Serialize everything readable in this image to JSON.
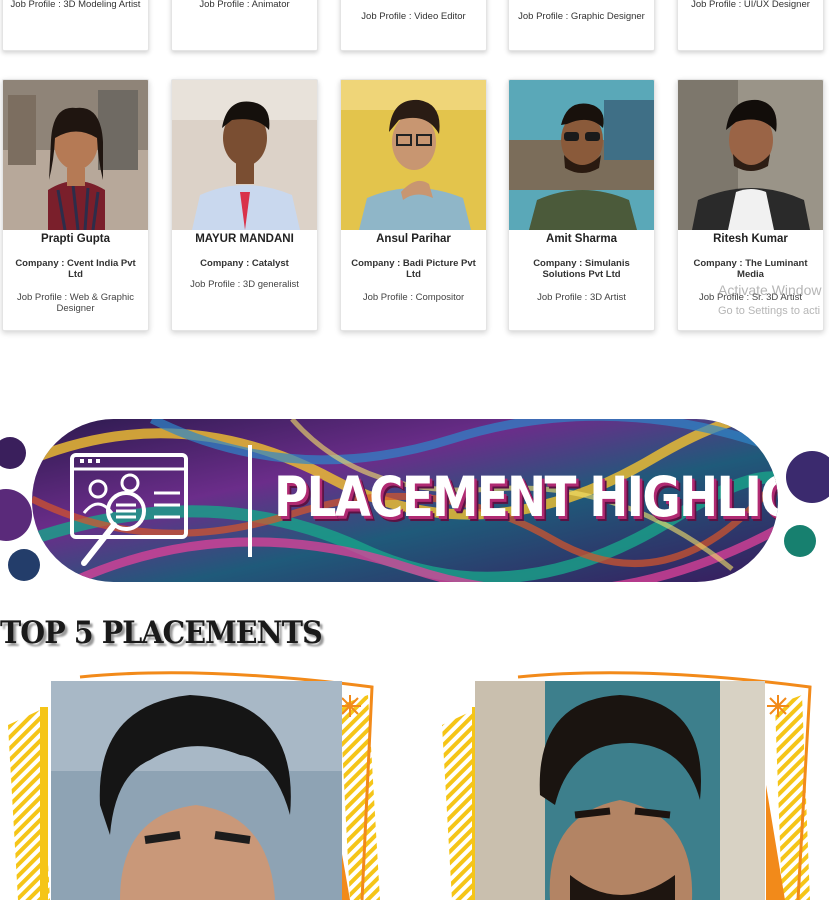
{
  "top_row": [
    {
      "job": "Job Profile : 3D Modeling Artist"
    },
    {
      "job": "Job Profile : Animator"
    },
    {
      "job": "Job Profile : Video Editor"
    },
    {
      "job": "Job Profile : Graphic Designer"
    },
    {
      "job": "Job Profile : UI/UX Designer"
    }
  ],
  "students": [
    {
      "name": "Prapti Gupta",
      "company": "Company : Cvent India Pvt Ltd",
      "job": "Job Profile : Web & Graphic Designer"
    },
    {
      "name": "MAYUR MANDANI",
      "company": "Company : Catalyst",
      "job": "Job Profile : 3D generalist"
    },
    {
      "name": "Ansul Parihar",
      "company": "Company : Badi Picture Pvt Ltd",
      "job": "Job Profile : Compositor"
    },
    {
      "name": "Amit Sharma",
      "company": "Company : Simulanis Solutions Pvt Ltd",
      "job": "Job Profile : 3D Artist"
    },
    {
      "name": "Ritesh Kumar",
      "company": "Company : The Luminant Media",
      "job": "Job Profile : Sr. 3D Artist"
    }
  ],
  "watermark": {
    "line1": "Activate Window",
    "line2": "Go to Settings to acti"
  },
  "banner": {
    "title": "PLACEMENT HIGHLIGHTS",
    "icon": "profile-search-icon"
  },
  "section": {
    "title": "TOP 5 PLACEMENTS"
  },
  "colors": {
    "accent_orange": "#f28a1a",
    "accent_yellow": "#f5c518",
    "banner_shadow": "#b02a72"
  }
}
